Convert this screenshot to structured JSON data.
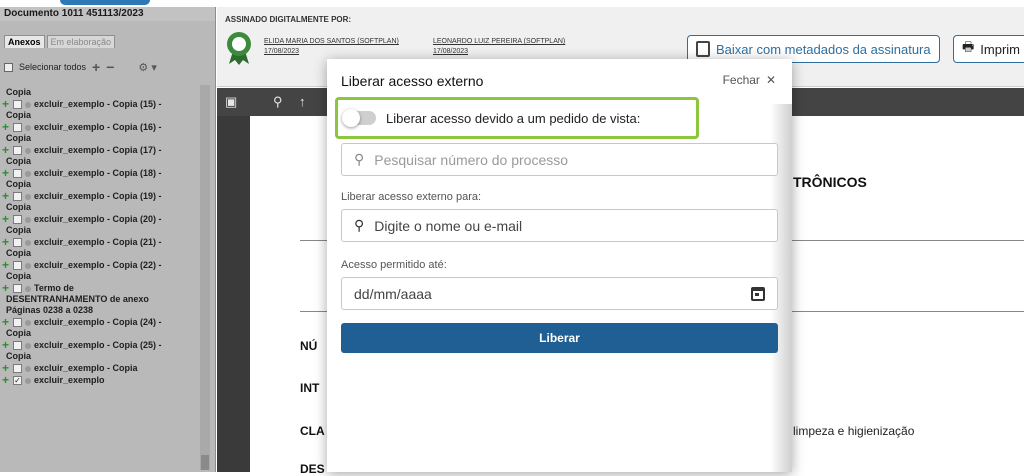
{
  "sidebar": {
    "doc_title": "Documento 1011 451113/2023",
    "tabs": [
      {
        "label": "Anexos"
      },
      {
        "label": "Em elaboração"
      }
    ],
    "select_all_label": "Selecionar todos",
    "items": [
      {
        "lines": [
          "Copia"
        ]
      },
      {
        "lines": [
          "excluir_exemplo - Copia (15) -",
          "Copia"
        ]
      },
      {
        "lines": [
          "excluir_exemplo - Copia (16) -",
          "Copia"
        ]
      },
      {
        "lines": [
          "excluir_exemplo - Copia (17) -",
          "Copia"
        ]
      },
      {
        "lines": [
          "excluir_exemplo - Copia (18) -",
          "Copia"
        ]
      },
      {
        "lines": [
          "excluir_exemplo - Copia (19) -",
          "Copia"
        ]
      },
      {
        "lines": [
          "excluir_exemplo - Copia (20) -",
          "Copia"
        ]
      },
      {
        "lines": [
          "excluir_exemplo - Copia (21) -",
          "Copia"
        ]
      },
      {
        "lines": [
          "excluir_exemplo - Copia (22) -",
          "Copia"
        ]
      },
      {
        "lines": [
          "Termo de",
          "DESENTRANHAMENTO de anexo",
          "Páginas 0238 a 0238"
        ]
      },
      {
        "lines": [
          "excluir_exemplo - Copia (24) -",
          "Copia"
        ]
      },
      {
        "lines": [
          "excluir_exemplo - Copia (25) -",
          "Copia"
        ]
      },
      {
        "lines": [
          "excluir_exemplo - Copia"
        ]
      },
      {
        "lines": [
          "excluir_exemplo"
        ],
        "checked": true
      }
    ]
  },
  "signature": {
    "label": "ASSINADO DIGITALMENTE POR:",
    "signer1_name": "ELIDA MARIA DOS SANTOS (SOFTPLAN)",
    "signer1_date": "17/08/2023",
    "signer2_name": "LEONARDO LUIZ PEREIRA (SOFTPLAN)",
    "signer2_date": "17/08/2023",
    "download_label": "Baixar com metadados da assinatura",
    "print_label": "Imprim"
  },
  "document": {
    "title_fragment": "TRÔNICOS",
    "field1": "NÚ",
    "field2": "INT",
    "field3": "CLA",
    "field4": "DES",
    "right_text": "limpeza e higienização"
  },
  "modal": {
    "title": "Liberar acesso externo",
    "close_label": "Fechar",
    "close_glyph": "✕",
    "toggle_label": "Liberar acesso devido a um pedido de vista:",
    "search_placeholder": "Pesquisar número do processo",
    "external_label": "Liberar acesso externo para:",
    "external_placeholder": "Digite o nome ou e-mail",
    "date_label": "Acesso permitido até:",
    "date_placeholder": "dd/mm/aaaa",
    "submit_label": "Liberar"
  },
  "colors": {
    "accent": "#1f5f93",
    "highlight": "#8cc63e"
  }
}
